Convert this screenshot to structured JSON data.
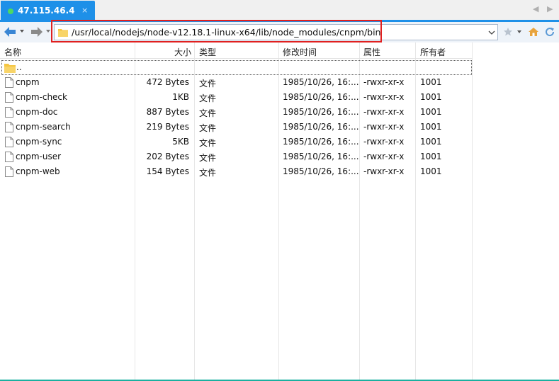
{
  "tab": {
    "title": "47.115.46.4",
    "close": "×"
  },
  "tab_nav": {
    "left": "◀",
    "right": "▶"
  },
  "address": {
    "path": "/usr/local/nodejs/node-v12.18.1-linux-x64/lib/node_modules/cnpm/bin"
  },
  "columns": {
    "name": "名称",
    "size": "大小",
    "type": "类型",
    "modified": "修改时间",
    "attrs": "属性",
    "owner": "所有者"
  },
  "parent_row": {
    "name": ".."
  },
  "files": [
    {
      "name": "cnpm",
      "size": "472 Bytes",
      "type": "文件",
      "modified": "1985/10/26, 16:...",
      "attrs": "-rwxr-xr-x",
      "owner": "1001"
    },
    {
      "name": "cnpm-check",
      "size": "1KB",
      "type": "文件",
      "modified": "1985/10/26, 16:...",
      "attrs": "-rwxr-xr-x",
      "owner": "1001"
    },
    {
      "name": "cnpm-doc",
      "size": "887 Bytes",
      "type": "文件",
      "modified": "1985/10/26, 16:...",
      "attrs": "-rwxr-xr-x",
      "owner": "1001"
    },
    {
      "name": "cnpm-search",
      "size": "219 Bytes",
      "type": "文件",
      "modified": "1985/10/26, 16:...",
      "attrs": "-rwxr-xr-x",
      "owner": "1001"
    },
    {
      "name": "cnpm-sync",
      "size": "5KB",
      "type": "文件",
      "modified": "1985/10/26, 16:...",
      "attrs": "-rwxr-xr-x",
      "owner": "1001"
    },
    {
      "name": "cnpm-user",
      "size": "202 Bytes",
      "type": "文件",
      "modified": "1985/10/26, 16:...",
      "attrs": "-rwxr-xr-x",
      "owner": "1001"
    },
    {
      "name": "cnpm-web",
      "size": "154 Bytes",
      "type": "文件",
      "modified": "1985/10/26, 16:...",
      "attrs": "-rwxr-xr-x",
      "owner": "1001"
    }
  ],
  "colors": {
    "tab_active": "#1e90e8",
    "connection_dot": "#4cd964",
    "highlight_box": "#e02020",
    "folder": "#f5c542"
  },
  "icons": {
    "back": "back-arrow-icon",
    "forward": "forward-arrow-icon",
    "folder": "folder-icon",
    "file": "file-icon",
    "favorite": "star-icon",
    "home": "home-icon",
    "refresh": "refresh-icon"
  }
}
